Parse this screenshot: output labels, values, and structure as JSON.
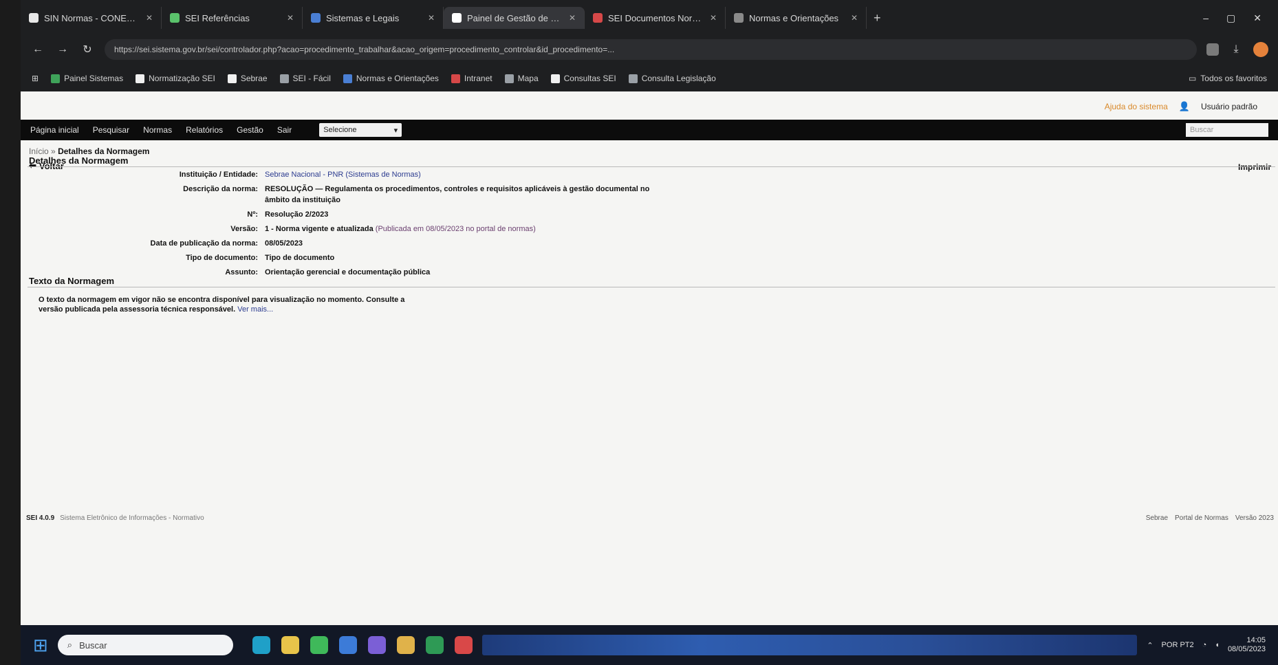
{
  "browser": {
    "tabs": [
      {
        "label": "SIN Normas - CONEN - Sebrah",
        "icon_color": "#e8e8e8",
        "active": false
      },
      {
        "label": "SEI Referências",
        "icon_color": "#5ac26b",
        "active": false
      },
      {
        "label": "Sistemas e Legais",
        "icon_color": "#4a7fd4",
        "active": false
      },
      {
        "label": "Painel de Gestão de Campos",
        "icon_color": "#ffffff",
        "active": true
      },
      {
        "label": "SEI Documentos Normas",
        "icon_color": "#d64848",
        "active": false
      },
      {
        "label": "Normas e Orientações",
        "icon_color": "#8a8a8a",
        "active": false
      }
    ],
    "new_tab": "+",
    "window_controls": [
      "–",
      "▢",
      "✕"
    ],
    "address": "https://sei.sistema.gov.br/sei/controlador.php?acao=procedimento_trabalhar&acao_origem=procedimento_controlar&id_procedimento=...",
    "bookmarks": [
      {
        "label": "Painel Sistemas",
        "color": "#3fa35a"
      },
      {
        "label": "Normatização SEI",
        "color": "#f0f0f0"
      },
      {
        "label": "Sebrae",
        "color": "#f0f0f0"
      },
      {
        "label": "SEI - Fácil",
        "color": "#9aa0a6"
      },
      {
        "label": "Normas e Orientações",
        "color": "#4a7fd4"
      },
      {
        "label": "Intranet",
        "color": "#d64848"
      },
      {
        "label": "Mapa",
        "color": "#9aa0a6"
      },
      {
        "label": "Consultas SEI",
        "color": "#f0f0f0"
      },
      {
        "label": "Consulta Legislação",
        "color": "#9aa0a6"
      }
    ],
    "all_bookmarks": "Todos os favoritos"
  },
  "page": {
    "user": {
      "help": "Ajuda do sistema",
      "name": "Usuário padrão"
    },
    "menu": [
      "Página inicial",
      "Pesquisar",
      "Normas",
      "Relatórios",
      "Gestão",
      "Sair"
    ],
    "menu_select": "Selecione",
    "menu_search_placeholder": "Buscar",
    "breadcrumb": {
      "home": "Início",
      "sep": "»",
      "current": "Detalhes da Normagem"
    },
    "voltar": "Voltar",
    "right_link": "Imprimir",
    "section1": "Detalhes da Normagem",
    "fields": [
      {
        "label": "Instituição / Entidade:",
        "value": "Sebrae Nacional - PNR (Sistemas de Normas)",
        "sub": ""
      },
      {
        "label": "Descrição da norma:",
        "value": "RESOLUÇÃO — Regulamenta os procedimentos, controles e requisitos aplicáveis à gestão documental no âmbito da instituição",
        "sub": ""
      },
      {
        "label": "Nº:",
        "value": "Resolução 2/2023",
        "sub": ""
      },
      {
        "label": "Versão:",
        "value": "1 - Norma vigente e atualizada",
        "sub": "(Publicada em 08/05/2023 no portal de normas)"
      },
      {
        "label": "Data de publicação da norma:",
        "value": "08/05/2023",
        "sub": ""
      },
      {
        "label": "Tipo de documento:",
        "value": "Tipo de documento",
        "sub": ""
      },
      {
        "label": "Assunto:",
        "value": "Orientação gerencial e documentação pública",
        "sub": ""
      }
    ],
    "section2": "Texto da Normagem",
    "text": "O texto da normagem em vigor não se encontra disponível para visualização no momento. Consulte a versão publicada pela assessoria técnica responsável.",
    "text_more": "Ver mais...",
    "footer": {
      "version": "SEI 4.0.9",
      "left": "Sistema Eletrônico de Informações - Normativo",
      "right": [
        "Sebrae",
        "Portal de Normas",
        "Versão 2023"
      ]
    }
  },
  "taskbar": {
    "search_placeholder": "Buscar",
    "apps": [
      {
        "name": "edge",
        "color": "#1fa0c8"
      },
      {
        "name": "explorer",
        "color": "#e8c44a"
      },
      {
        "name": "chrome",
        "color": "#3fb95a"
      },
      {
        "name": "store",
        "color": "#3c7bd8"
      },
      {
        "name": "teams",
        "color": "#7b5fd6"
      },
      {
        "name": "files",
        "color": "#e0b24a"
      },
      {
        "name": "excel",
        "color": "#2e9a55"
      },
      {
        "name": "record",
        "color": "#d94848"
      }
    ],
    "tray_lang": "POR PT2",
    "time": "14:05",
    "date": "08/05/2023"
  }
}
